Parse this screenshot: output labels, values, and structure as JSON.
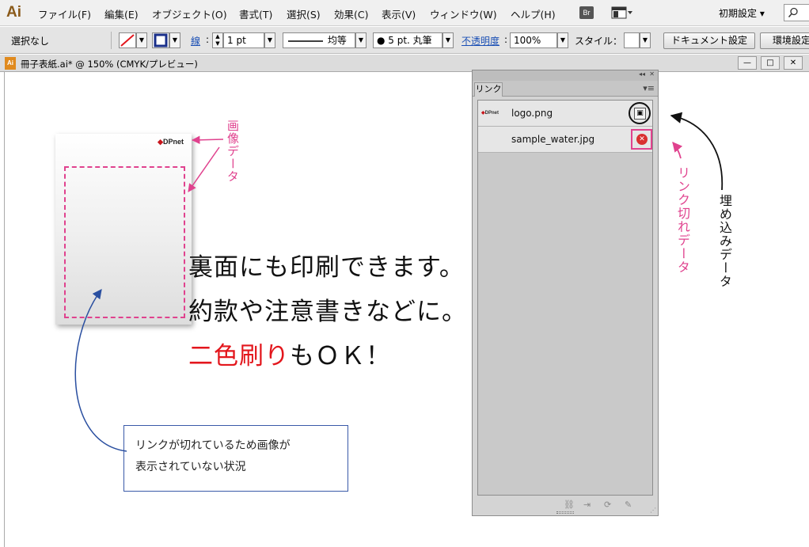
{
  "app": {
    "logo": "Ai"
  },
  "menu": {
    "items": [
      "ファイル(F)",
      "編集(E)",
      "オブジェクト(O)",
      "書式(T)",
      "選択(S)",
      "効果(C)",
      "表示(V)",
      "ウィンドウ(W)",
      "ヘルプ(H)"
    ],
    "bridge_label": "Br",
    "workspace": "初期設定 ▾"
  },
  "control": {
    "selection": "選択なし",
    "stroke_label": "線",
    "stroke_weight": "1 pt",
    "stroke_profile": "均等",
    "brush": "● 5 pt. 丸筆",
    "opacity_label": "不透明度",
    "opacity_value": "100%",
    "style_label": "スタイル：",
    "doc_settings": "ドキュメント設定",
    "preferences": "環境設定"
  },
  "document": {
    "icon_label": "Ai",
    "title": "冊子表紙.ai* @ 150% (CMYK/プレビュー)",
    "min_btn": "—",
    "max_btn": "□",
    "close_btn": "✕"
  },
  "artboard": {
    "logo_text": "DPnet",
    "line1": "裏面にも印刷できます。",
    "line2": "約款や注意書きなどに。",
    "line3_red": "二色刷り",
    "line3_rest": "もＯＫ！",
    "note_line1": "リンクが切れているため画像が",
    "note_line2": "表示されていない状況"
  },
  "annotations": {
    "image_data": "画像データ",
    "broken_link": "リンク切れデータ",
    "embedded": "埋め込みデータ"
  },
  "links_panel": {
    "tab": "リンク",
    "collapse": "◂◂",
    "close": "✕",
    "menu": "▾≡",
    "items": [
      {
        "thumb": "DPnet",
        "name": "logo.png",
        "status": "embedded"
      },
      {
        "thumb": "",
        "name": "sample_water.jpg",
        "status": "missing"
      }
    ],
    "footer_icons": [
      "relink-icon",
      "goto-link-icon",
      "update-link-icon",
      "edit-original-icon"
    ]
  },
  "colors": {
    "annotation_pink": "#e0428e",
    "red_text": "#e3161c",
    "note_border": "#3a5aa8"
  }
}
